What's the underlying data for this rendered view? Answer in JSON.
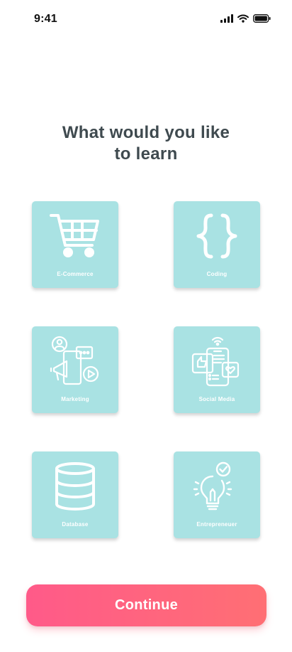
{
  "status_bar": {
    "time": "9:41",
    "icons": [
      "cellular-signal-icon",
      "wifi-icon",
      "battery-icon"
    ]
  },
  "title": {
    "line1": "What would you like",
    "line2": "to learn"
  },
  "topics": [
    {
      "label": "E-Commerce",
      "icon": "shopping-cart-icon"
    },
    {
      "label": "Coding",
      "icon": "curly-braces-icon"
    },
    {
      "label": "Marketing",
      "icon": "megaphone-icon"
    },
    {
      "label": "Social Media",
      "icon": "smartphone-social-icon"
    },
    {
      "label": "Database",
      "icon": "database-icon"
    },
    {
      "label": "Entrepreneuer",
      "icon": "lightbulb-icon"
    }
  ],
  "continue_label": "Continue",
  "colors": {
    "card_background": "#a9e2e3",
    "title_text": "#3f4a4f",
    "button_gradient_start": "#ff5a89",
    "button_gradient_end": "#ff6f74",
    "card_label": "#ffffff"
  }
}
